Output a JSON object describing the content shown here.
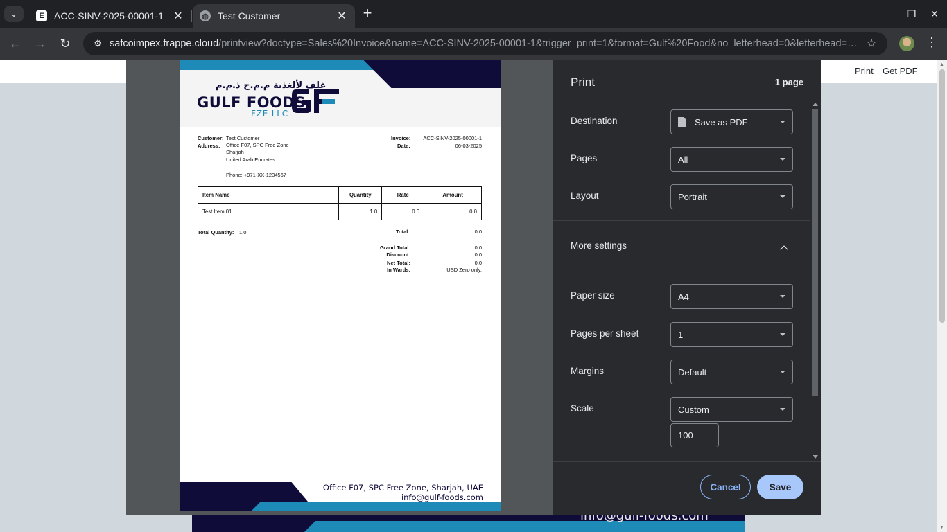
{
  "browser": {
    "tabs": [
      {
        "favicon": "E",
        "title": "ACC-SINV-2025-00001-1",
        "close": "✕"
      },
      {
        "favicon": "◍",
        "title": "Test Customer",
        "close": "✕"
      }
    ],
    "new_tab": "+",
    "tab_search": "⌄",
    "window_controls": {
      "minimize": "—",
      "restore": "❐",
      "close": "✕"
    },
    "nav": {
      "back": "←",
      "forward": "→",
      "reload": "↻"
    },
    "url_host": "safcoimpex.frappe.cloud",
    "url_path": "/printview?doctype=Sales%20Invoice&name=ACC-SINV-2025-00001-1&trigger_print=1&format=Gulf%20Food&no_letterhead=0&letterhead=Gulf…",
    "site_info_icon": "⚙",
    "star_icon": "☆",
    "menu_icon": "⋮"
  },
  "page": {
    "links": {
      "print": "Print",
      "get_pdf": "Get PDF"
    },
    "footer_email_partial": "info@gulf-foods.com"
  },
  "invoice": {
    "logo_arabic": "غلف لألغذية م.م.ح ذ.م.م",
    "logo_name": "GULF FOODS",
    "logo_sub": "FZE LLC",
    "customer_label": "Customer:",
    "customer": "Test Customer",
    "address_label": "Address:",
    "address_lines": [
      "Office F07, SPC Free Zone",
      "Sharjah",
      "United Arab Emirates",
      "",
      "Phone: +971-XX-1234567"
    ],
    "invoice_label": "Invoice:",
    "invoice_no": "ACC-SINV-2025-00001-1",
    "date_label": "Date:",
    "date": "06-03-2025",
    "columns": [
      "Item Name",
      "Quantity",
      "Rate",
      "Amount"
    ],
    "rows": [
      [
        "Test Item 01",
        "1.0",
        "0.0",
        "0.0"
      ]
    ],
    "total_qty_label": "Total Quantity:",
    "total_qty": "1.0",
    "total_label": "Total:",
    "total": "0.0",
    "grand_total_label": "Grand Total:",
    "grand_total": "0.0",
    "discount_label": "Discount:",
    "discount": "0.0",
    "net_total_label": "Net Total:",
    "net_total": "0.0",
    "in_words_label": "In Wards:",
    "in_words": "USD Zero only.",
    "footer_address": "Office F07, SPC Free Zone, Sharjah, UAE",
    "footer_email": "info@gulf-foods.com",
    "colors": {
      "navy": "#100c3a",
      "blue": "#1d8ab8"
    }
  },
  "print_dialog": {
    "title": "Print",
    "page_count": "1 page",
    "destination": {
      "label": "Destination",
      "value": "Save as PDF"
    },
    "pages": {
      "label": "Pages",
      "value": "All"
    },
    "layout": {
      "label": "Layout",
      "value": "Portrait"
    },
    "more_settings": "More settings",
    "paper_size": {
      "label": "Paper size",
      "value": "A4"
    },
    "pages_per_sheet": {
      "label": "Pages per sheet",
      "value": "1"
    },
    "margins": {
      "label": "Margins",
      "value": "Default"
    },
    "scale": {
      "label": "Scale",
      "value": "Custom",
      "input": "100"
    },
    "cancel": "Cancel",
    "save": "Save"
  }
}
